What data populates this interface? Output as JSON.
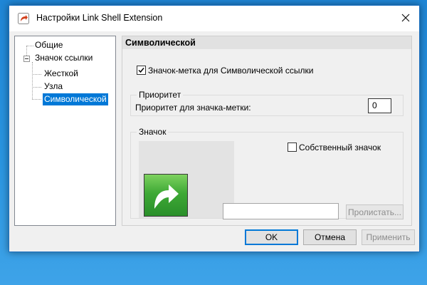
{
  "window": {
    "title": "Настройки Link Shell Extension",
    "app_icon": "link-shell-extension-icon",
    "close_icon": "close-icon"
  },
  "tree": {
    "items": [
      {
        "label": "Общие",
        "level": 0,
        "selected": false
      },
      {
        "label": "Значок ссылки",
        "level": 0,
        "selected": false,
        "expanded": true
      },
      {
        "label": "Жесткой",
        "level": 1,
        "selected": false
      },
      {
        "label": "Узла",
        "level": 1,
        "selected": false
      },
      {
        "label": "Символической",
        "level": 1,
        "selected": true
      }
    ]
  },
  "panel": {
    "header": "Символической",
    "overlay_checkbox": {
      "label": "Значок-метка для Символической ссылки",
      "checked": true
    },
    "priority_group": {
      "title": "Приоритет",
      "label": "Приоритет для значка-метки:",
      "value": "0"
    },
    "icon_group": {
      "title": "Значок",
      "own_icon_checkbox": {
        "label": "Собственный значок",
        "checked": false
      },
      "path_value": "",
      "browse_button": "Пролистать...",
      "preview_icon": "green-arrow-icon"
    }
  },
  "buttons": {
    "ok": "OK",
    "cancel": "Отмена",
    "apply": "Применить"
  },
  "colors": {
    "selection": "#0078d7",
    "desktop": "#1f86d6",
    "icon_green": "#3ea935"
  }
}
